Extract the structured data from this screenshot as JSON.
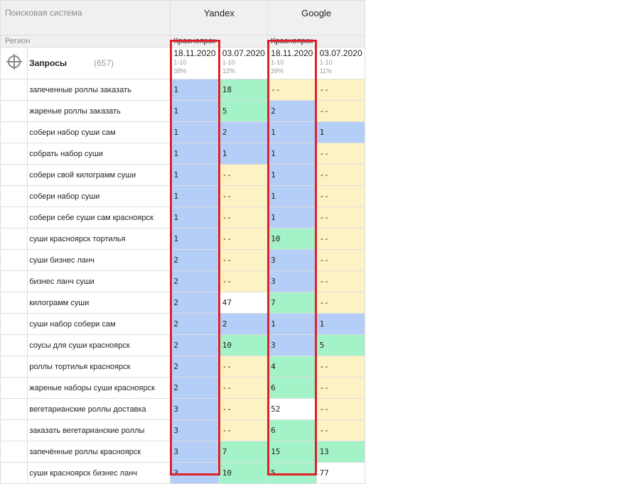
{
  "header": {
    "search_engine_label": "Поисковая система",
    "region_label": "Регион",
    "queries_label": "Запросы",
    "queries_count": "(657)",
    "engines": [
      {
        "name": "Yandex",
        "region": "Красноярск"
      },
      {
        "name": "Google",
        "region": "Красноярск"
      }
    ],
    "columns": [
      {
        "date": "18.11.2020",
        "range": "1-10",
        "pct": "38%"
      },
      {
        "date": "03.07.2020",
        "range": "1-10",
        "pct": "12%"
      },
      {
        "date": "18.11.2020",
        "range": "1-10",
        "pct": "39%"
      },
      {
        "date": "03.07.2020",
        "range": "1-10",
        "pct": "11%"
      }
    ]
  },
  "colors": {
    "blue": "#b5cef8",
    "green": "#a4f2c8",
    "yellow": "#fdf2c4",
    "highlight": "#e0202a"
  },
  "rows": [
    {
      "kw": "запеченные роллы заказать",
      "v": [
        "1",
        "18",
        "--",
        "--"
      ]
    },
    {
      "kw": "жареные роллы заказать",
      "v": [
        "1",
        "5",
        "2",
        "--"
      ]
    },
    {
      "kw": "собери набор суши сам",
      "v": [
        "1",
        "2",
        "1",
        "1"
      ]
    },
    {
      "kw": "собрать набор суши",
      "v": [
        "1",
        "1",
        "1",
        "--"
      ]
    },
    {
      "kw": "собери свой килограмм суши",
      "v": [
        "1",
        "--",
        "1",
        "--"
      ]
    },
    {
      "kw": "собери набор суши",
      "v": [
        "1",
        "--",
        "1",
        "--"
      ]
    },
    {
      "kw": "собери себе суши сам красноярск",
      "v": [
        "1",
        "--",
        "1",
        "--"
      ]
    },
    {
      "kw": "суши красноярск тортилья",
      "v": [
        "1",
        "--",
        "10",
        "--"
      ]
    },
    {
      "kw": "суши бизнес ланч",
      "v": [
        "2",
        "--",
        "3",
        "--"
      ]
    },
    {
      "kw": "бизнес ланч суши",
      "v": [
        "2",
        "--",
        "3",
        "--"
      ]
    },
    {
      "kw": "килограмм суши",
      "v": [
        "2",
        "47",
        "7",
        "--"
      ]
    },
    {
      "kw": "суши набор собери сам",
      "v": [
        "2",
        "2",
        "1",
        "1"
      ]
    },
    {
      "kw": "соусы для суши красноярск",
      "v": [
        "2",
        "10",
        "3",
        "5"
      ]
    },
    {
      "kw": "роллы тортилья красноярск",
      "v": [
        "2",
        "--",
        "4",
        "--"
      ]
    },
    {
      "kw": "жареные наборы суши красноярск",
      "v": [
        "2",
        "--",
        "6",
        "--"
      ]
    },
    {
      "kw": "вегетарианские роллы доставка",
      "v": [
        "3",
        "--",
        "52",
        "--"
      ]
    },
    {
      "kw": "заказать вегетарианские роллы",
      "v": [
        "3",
        "--",
        "6",
        "--"
      ]
    },
    {
      "kw": "запечённые роллы красноярск",
      "v": [
        "3",
        "7",
        "15",
        "13"
      ]
    },
    {
      "kw": "суши красноярск бизнес ланч",
      "v": [
        "3",
        "10",
        "5",
        "77"
      ]
    }
  ]
}
